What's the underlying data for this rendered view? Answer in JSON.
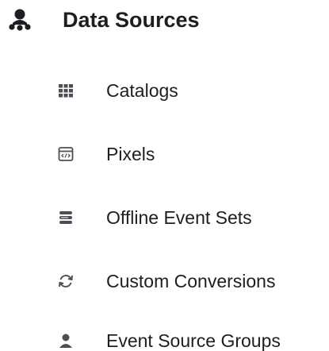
{
  "header": {
    "title": "Data Sources",
    "icon": "data-sources-icon"
  },
  "nav": {
    "items": [
      {
        "label": "Catalogs",
        "icon": "grid-icon"
      },
      {
        "label": "Pixels",
        "icon": "code-window-icon"
      },
      {
        "label": "Offline Event Sets",
        "icon": "stack-icon"
      },
      {
        "label": "Custom Conversions",
        "icon": "refresh-icon"
      },
      {
        "label": "Event Source Groups",
        "icon": "person-icon"
      }
    ]
  },
  "colors": {
    "text": "#1c1e21",
    "icon": "#4b4f56",
    "background": "#ffffff"
  }
}
